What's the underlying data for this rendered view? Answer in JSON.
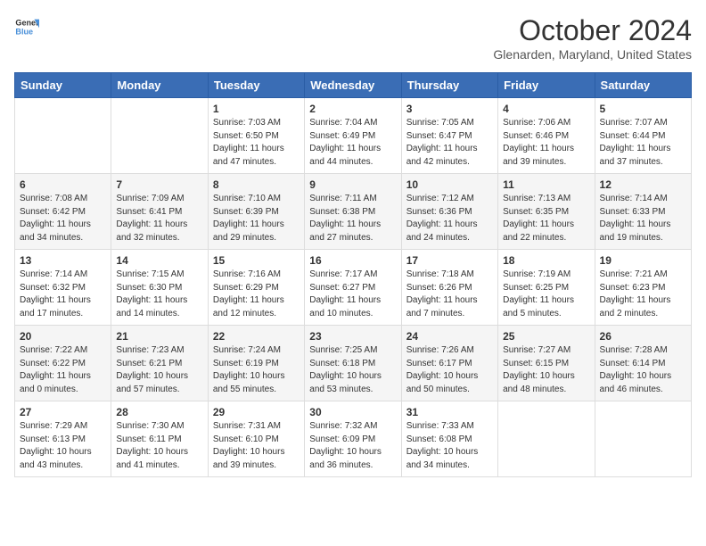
{
  "header": {
    "logo_line1": "General",
    "logo_line2": "Blue",
    "month_title": "October 2024",
    "subtitle": "Glenarden, Maryland, United States"
  },
  "weekdays": [
    "Sunday",
    "Monday",
    "Tuesday",
    "Wednesday",
    "Thursday",
    "Friday",
    "Saturday"
  ],
  "weeks": [
    [
      {
        "day": "",
        "content": ""
      },
      {
        "day": "",
        "content": ""
      },
      {
        "day": "1",
        "content": "Sunrise: 7:03 AM\nSunset: 6:50 PM\nDaylight: 11 hours and 47 minutes."
      },
      {
        "day": "2",
        "content": "Sunrise: 7:04 AM\nSunset: 6:49 PM\nDaylight: 11 hours and 44 minutes."
      },
      {
        "day": "3",
        "content": "Sunrise: 7:05 AM\nSunset: 6:47 PM\nDaylight: 11 hours and 42 minutes."
      },
      {
        "day": "4",
        "content": "Sunrise: 7:06 AM\nSunset: 6:46 PM\nDaylight: 11 hours and 39 minutes."
      },
      {
        "day": "5",
        "content": "Sunrise: 7:07 AM\nSunset: 6:44 PM\nDaylight: 11 hours and 37 minutes."
      }
    ],
    [
      {
        "day": "6",
        "content": "Sunrise: 7:08 AM\nSunset: 6:42 PM\nDaylight: 11 hours and 34 minutes."
      },
      {
        "day": "7",
        "content": "Sunrise: 7:09 AM\nSunset: 6:41 PM\nDaylight: 11 hours and 32 minutes."
      },
      {
        "day": "8",
        "content": "Sunrise: 7:10 AM\nSunset: 6:39 PM\nDaylight: 11 hours and 29 minutes."
      },
      {
        "day": "9",
        "content": "Sunrise: 7:11 AM\nSunset: 6:38 PM\nDaylight: 11 hours and 27 minutes."
      },
      {
        "day": "10",
        "content": "Sunrise: 7:12 AM\nSunset: 6:36 PM\nDaylight: 11 hours and 24 minutes."
      },
      {
        "day": "11",
        "content": "Sunrise: 7:13 AM\nSunset: 6:35 PM\nDaylight: 11 hours and 22 minutes."
      },
      {
        "day": "12",
        "content": "Sunrise: 7:14 AM\nSunset: 6:33 PM\nDaylight: 11 hours and 19 minutes."
      }
    ],
    [
      {
        "day": "13",
        "content": "Sunrise: 7:14 AM\nSunset: 6:32 PM\nDaylight: 11 hours and 17 minutes."
      },
      {
        "day": "14",
        "content": "Sunrise: 7:15 AM\nSunset: 6:30 PM\nDaylight: 11 hours and 14 minutes."
      },
      {
        "day": "15",
        "content": "Sunrise: 7:16 AM\nSunset: 6:29 PM\nDaylight: 11 hours and 12 minutes."
      },
      {
        "day": "16",
        "content": "Sunrise: 7:17 AM\nSunset: 6:27 PM\nDaylight: 11 hours and 10 minutes."
      },
      {
        "day": "17",
        "content": "Sunrise: 7:18 AM\nSunset: 6:26 PM\nDaylight: 11 hours and 7 minutes."
      },
      {
        "day": "18",
        "content": "Sunrise: 7:19 AM\nSunset: 6:25 PM\nDaylight: 11 hours and 5 minutes."
      },
      {
        "day": "19",
        "content": "Sunrise: 7:21 AM\nSunset: 6:23 PM\nDaylight: 11 hours and 2 minutes."
      }
    ],
    [
      {
        "day": "20",
        "content": "Sunrise: 7:22 AM\nSunset: 6:22 PM\nDaylight: 11 hours and 0 minutes."
      },
      {
        "day": "21",
        "content": "Sunrise: 7:23 AM\nSunset: 6:21 PM\nDaylight: 10 hours and 57 minutes."
      },
      {
        "day": "22",
        "content": "Sunrise: 7:24 AM\nSunset: 6:19 PM\nDaylight: 10 hours and 55 minutes."
      },
      {
        "day": "23",
        "content": "Sunrise: 7:25 AM\nSunset: 6:18 PM\nDaylight: 10 hours and 53 minutes."
      },
      {
        "day": "24",
        "content": "Sunrise: 7:26 AM\nSunset: 6:17 PM\nDaylight: 10 hours and 50 minutes."
      },
      {
        "day": "25",
        "content": "Sunrise: 7:27 AM\nSunset: 6:15 PM\nDaylight: 10 hours and 48 minutes."
      },
      {
        "day": "26",
        "content": "Sunrise: 7:28 AM\nSunset: 6:14 PM\nDaylight: 10 hours and 46 minutes."
      }
    ],
    [
      {
        "day": "27",
        "content": "Sunrise: 7:29 AM\nSunset: 6:13 PM\nDaylight: 10 hours and 43 minutes."
      },
      {
        "day": "28",
        "content": "Sunrise: 7:30 AM\nSunset: 6:11 PM\nDaylight: 10 hours and 41 minutes."
      },
      {
        "day": "29",
        "content": "Sunrise: 7:31 AM\nSunset: 6:10 PM\nDaylight: 10 hours and 39 minutes."
      },
      {
        "day": "30",
        "content": "Sunrise: 7:32 AM\nSunset: 6:09 PM\nDaylight: 10 hours and 36 minutes."
      },
      {
        "day": "31",
        "content": "Sunrise: 7:33 AM\nSunset: 6:08 PM\nDaylight: 10 hours and 34 minutes."
      },
      {
        "day": "",
        "content": ""
      },
      {
        "day": "",
        "content": ""
      }
    ]
  ]
}
